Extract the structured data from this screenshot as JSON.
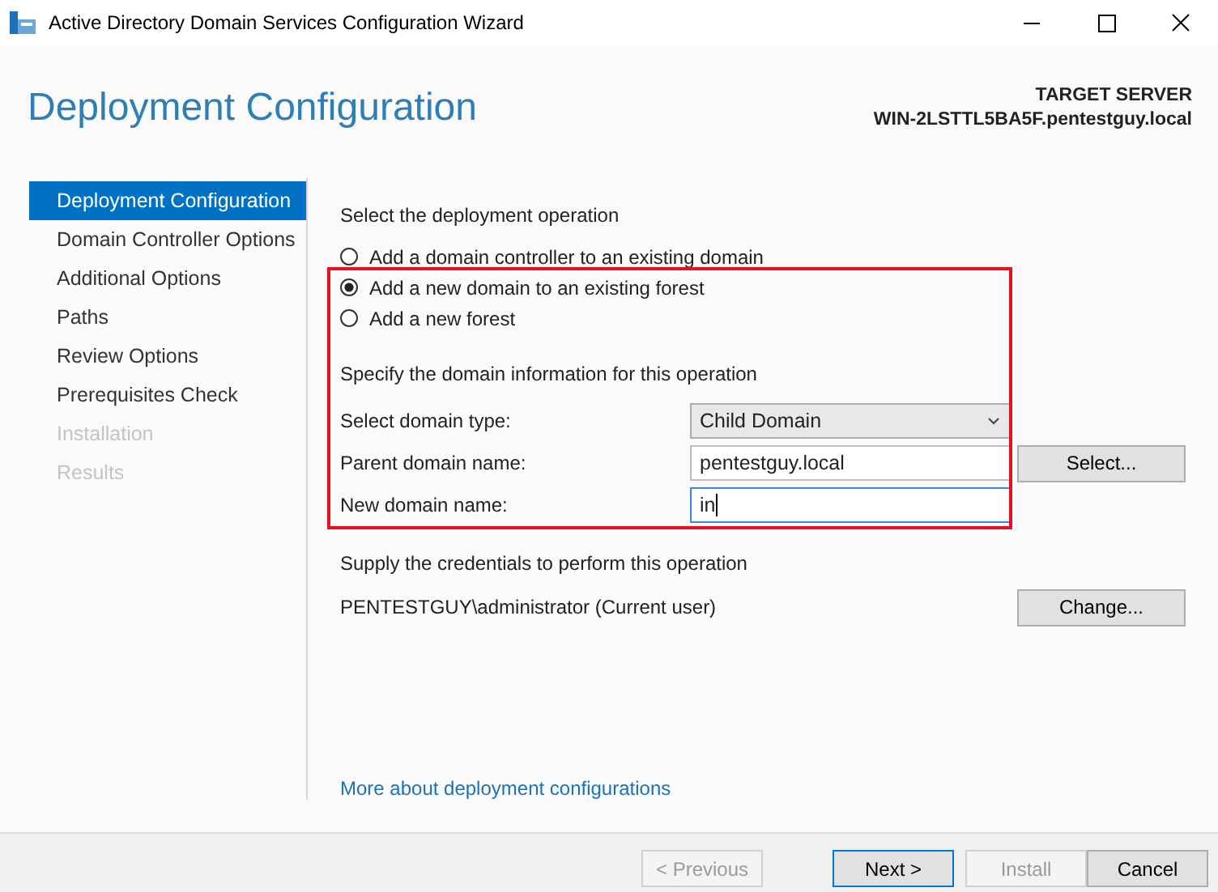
{
  "window": {
    "title": "Active Directory Domain Services Configuration Wizard"
  },
  "header": {
    "title": "Deployment Configuration",
    "target_label": "TARGET SERVER",
    "target_server": "WIN-2LSTTL5BA5F.pentestguy.local"
  },
  "sidebar": {
    "items": [
      {
        "label": "Deployment Configuration",
        "selected": true,
        "disabled": false
      },
      {
        "label": "Domain Controller Options",
        "selected": false,
        "disabled": false
      },
      {
        "label": "Additional Options",
        "selected": false,
        "disabled": false
      },
      {
        "label": "Paths",
        "selected": false,
        "disabled": false
      },
      {
        "label": "Review Options",
        "selected": false,
        "disabled": false
      },
      {
        "label": "Prerequisites Check",
        "selected": false,
        "disabled": false
      },
      {
        "label": "Installation",
        "selected": false,
        "disabled": true
      },
      {
        "label": "Results",
        "selected": false,
        "disabled": true
      }
    ]
  },
  "operation": {
    "heading": "Select the deployment operation",
    "options": [
      {
        "label": "Add a domain controller to an existing domain",
        "selected": false
      },
      {
        "label": "Add a new domain to an existing forest",
        "selected": true
      },
      {
        "label": "Add a new forest",
        "selected": false
      }
    ]
  },
  "domain_info": {
    "heading": "Specify the domain information for this operation",
    "fields": [
      {
        "kind": "dropdown",
        "label": "Select domain type:",
        "value": "Child Domain",
        "focused": false
      },
      {
        "kind": "text",
        "label": "Parent domain name:",
        "value": "pentestguy.local",
        "focused": false,
        "button": "Select..."
      },
      {
        "kind": "text",
        "label": "New domain name:",
        "value": "in",
        "focused": true
      }
    ]
  },
  "credentials": {
    "heading": "Supply the credentials to perform this operation",
    "user": "PENTESTGUY\\administrator (Current user)",
    "button": "Change..."
  },
  "link": "More about deployment configurations",
  "footer": {
    "buttons": [
      {
        "label": "< Previous",
        "disabled": true,
        "default": false
      },
      {
        "label": "Next >",
        "disabled": false,
        "default": true
      },
      {
        "label": "Install",
        "disabled": true,
        "default": false
      },
      {
        "label": "Cancel",
        "disabled": false,
        "default": false
      }
    ]
  }
}
